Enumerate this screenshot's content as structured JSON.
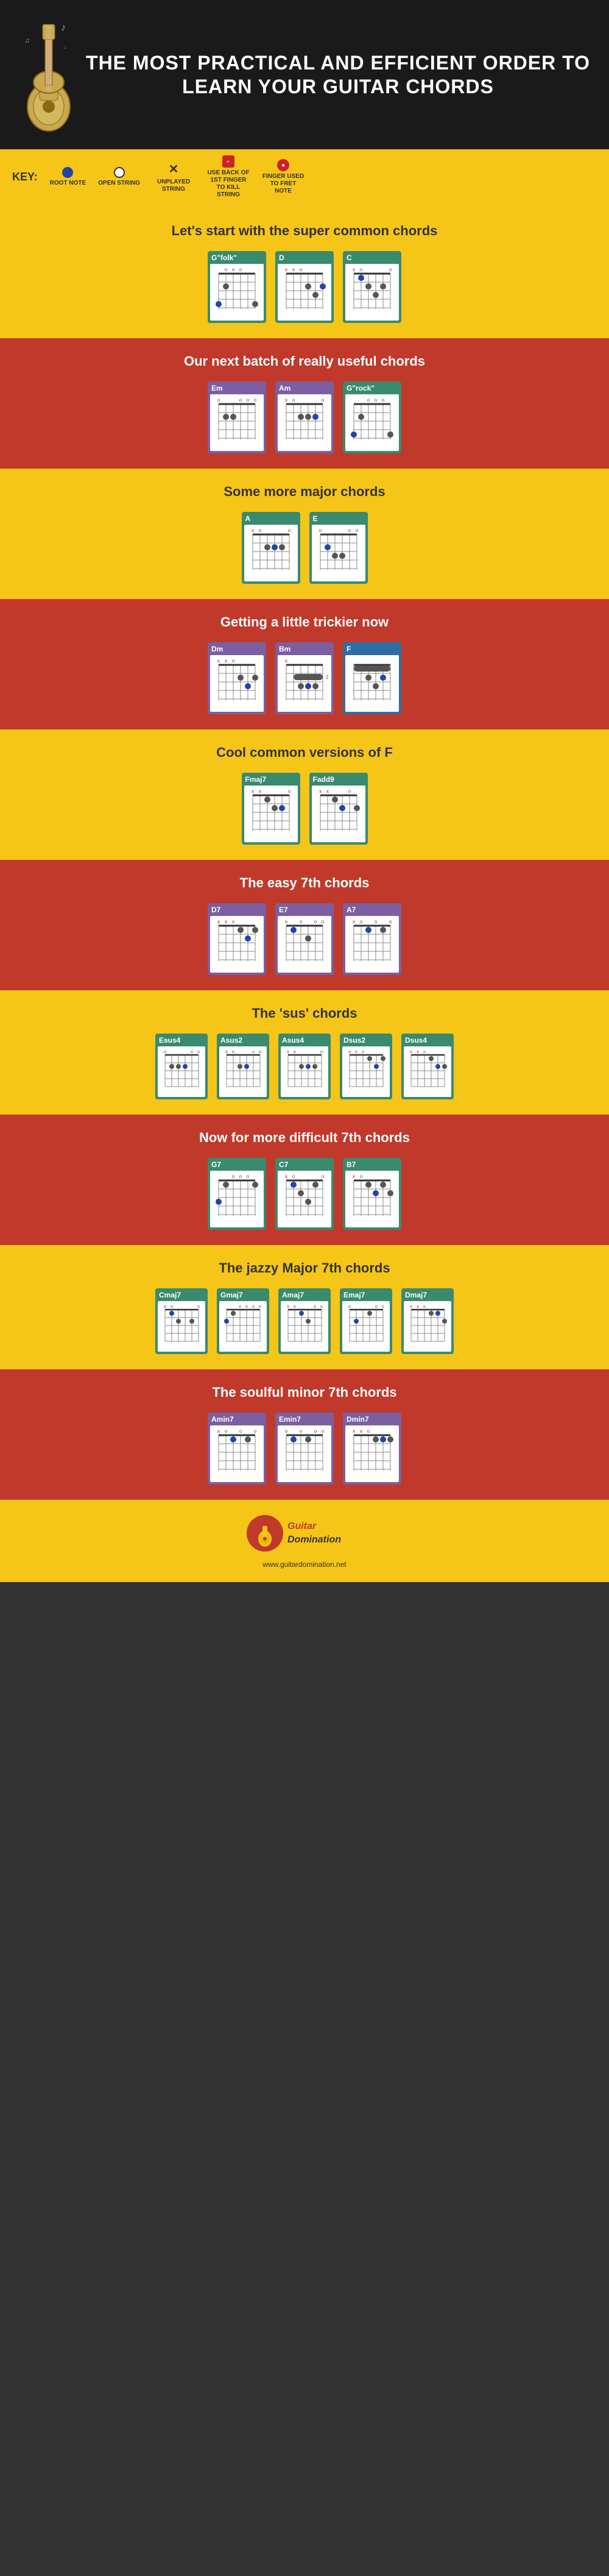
{
  "header": {
    "title": "THE MOST PRACTICAL AND EFFICIENT ORDER TO LEARN YOUR GUITAR CHORDS"
  },
  "key": {
    "label": "KEY:",
    "items": [
      {
        "id": "root-note",
        "symbol": "dot-blue",
        "label": "ROOT NOTE"
      },
      {
        "id": "open-string",
        "symbol": "dot-open",
        "label": "OPEN STRING"
      },
      {
        "id": "unplayed-string",
        "symbol": "X",
        "label": "UNPLAYED STRING"
      },
      {
        "id": "use-back",
        "symbol": "use-back-icon",
        "label": "USE BACK OF 1ST FINGER TO KILL STRING"
      },
      {
        "id": "fret-note",
        "symbol": "fret-icon",
        "label": "FINGER USED TO FRET NOTE"
      }
    ]
  },
  "sections": [
    {
      "id": "super-common",
      "bg": "yellow",
      "title": "Let's start with the super common chords",
      "chords": [
        {
          "name": "G\"folk\"",
          "color": "teal"
        },
        {
          "name": "D",
          "color": "teal"
        },
        {
          "name": "C",
          "color": "teal"
        }
      ]
    },
    {
      "id": "really-useful",
      "bg": "red",
      "title": "Our next batch of really useful chords",
      "chords": [
        {
          "name": "Em",
          "color": "purple"
        },
        {
          "name": "Am",
          "color": "purple"
        },
        {
          "name": "G\"rock\"",
          "color": "teal"
        }
      ]
    },
    {
      "id": "major-chords",
      "bg": "yellow",
      "title": "Some more major chords",
      "chords": [
        {
          "name": "A",
          "color": "teal"
        },
        {
          "name": "E",
          "color": "teal"
        }
      ]
    },
    {
      "id": "trickier",
      "bg": "red",
      "title": "Getting a little trickier now",
      "chords": [
        {
          "name": "Dm",
          "color": "purple"
        },
        {
          "name": "Bm",
          "color": "purple"
        },
        {
          "name": "F",
          "color": "blue"
        }
      ]
    },
    {
      "id": "versions-f",
      "bg": "yellow",
      "title": "Cool common versions of F",
      "chords": [
        {
          "name": "Fmaj7",
          "color": "teal"
        },
        {
          "name": "Fadd9",
          "color": "teal"
        }
      ]
    },
    {
      "id": "easy-7th",
      "bg": "red",
      "title": "The easy 7th chords",
      "chords": [
        {
          "name": "D7",
          "color": "purple"
        },
        {
          "name": "E7",
          "color": "purple"
        },
        {
          "name": "A7",
          "color": "purple"
        }
      ]
    },
    {
      "id": "sus-chords",
      "bg": "yellow",
      "title": "The 'sus' chords",
      "chords": [
        {
          "name": "Esus4",
          "color": "teal"
        },
        {
          "name": "Asus2",
          "color": "teal"
        },
        {
          "name": "Asus4",
          "color": "teal"
        },
        {
          "name": "Dsus2",
          "color": "teal"
        },
        {
          "name": "Dsus4",
          "color": "teal"
        }
      ]
    },
    {
      "id": "difficult-7th",
      "bg": "red",
      "title": "Now for more difficult 7th chords",
      "chords": [
        {
          "name": "G7",
          "color": "teal"
        },
        {
          "name": "C7",
          "color": "teal"
        },
        {
          "name": "B7",
          "color": "teal"
        }
      ]
    },
    {
      "id": "jazzy-major7",
      "bg": "yellow",
      "title": "The jazzy Major 7th chords",
      "chords": [
        {
          "name": "Cmaj7",
          "color": "teal"
        },
        {
          "name": "Gmaj7",
          "color": "teal"
        },
        {
          "name": "Amaj7",
          "color": "teal"
        },
        {
          "name": "Emaj7",
          "color": "teal"
        },
        {
          "name": "Dmaj7",
          "color": "teal"
        }
      ]
    },
    {
      "id": "soulful-minor7",
      "bg": "red",
      "title": "The soulful minor 7th chords",
      "chords": [
        {
          "name": "Amin7",
          "color": "purple"
        },
        {
          "name": "Emin7",
          "color": "purple"
        },
        {
          "name": "Dmin7",
          "color": "purple"
        }
      ]
    }
  ],
  "footer": {
    "logo_guitar": "Guitar",
    "logo_dom": "Domination",
    "url": "www.guitardomination.net"
  }
}
